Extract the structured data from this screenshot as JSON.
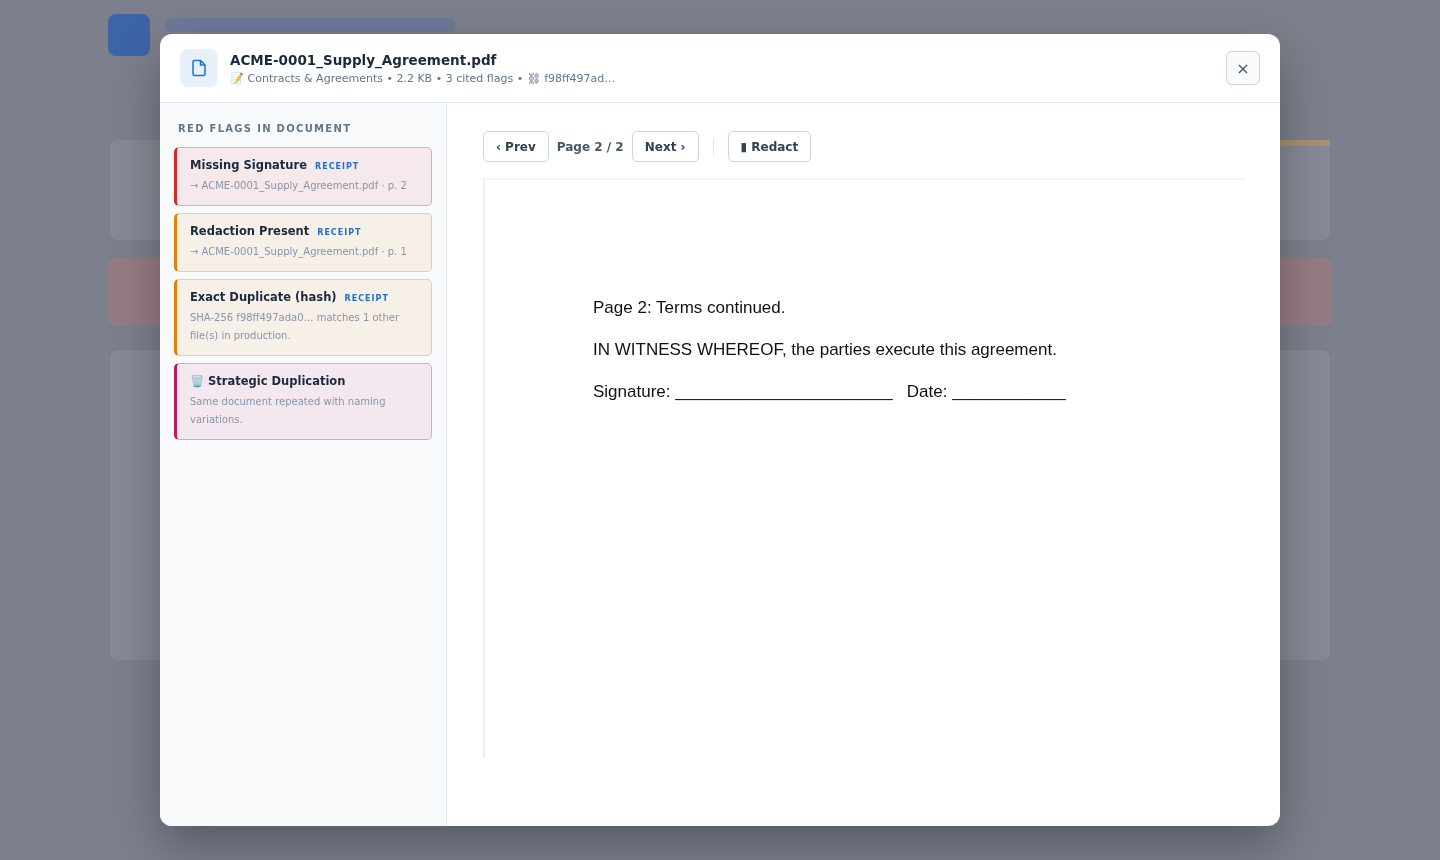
{
  "dialog": {
    "title": "ACME-0001_Supply_Agreement.pdf",
    "meta": "📝 Contracts & Agreements • 2.2 KB • 3 cited flags • ⛓ f98ff497ad…",
    "close": "×"
  },
  "sidebar": {
    "heading": "RED FLAGS IN DOCUMENT",
    "flags": [
      {
        "title": "Missing Signature",
        "tag": "RECEIPT",
        "detail": "→ ACME-0001_Supply_Agreement.pdf · p. 2",
        "color": "#dc2626"
      },
      {
        "title": "Redaction Present",
        "tag": "RECEIPT",
        "detail": "→ ACME-0001_Supply_Agreement.pdf · p. 1",
        "color": "#e67e0a"
      },
      {
        "title": "Exact Duplicate (hash)",
        "tag": "RECEIPT",
        "detail": "SHA-256 f98ff497ada0… matches 1 other file(s) in production.",
        "color": "#e67e0a"
      },
      {
        "title": "🗑️ Strategic Duplication",
        "detail": "Same document repeated with naming variations.",
        "color": "#be185d"
      }
    ]
  },
  "viewer": {
    "prev": "‹ Prev",
    "page": "Page 2 / 2",
    "next": "Next ›",
    "redact": "▮ Redact",
    "lines": [
      "Page 2: Terms continued.",
      "IN WITNESS WHEREOF, the parties execute this agreement.",
      "Signature: _______________________   Date: ____________"
    ]
  }
}
